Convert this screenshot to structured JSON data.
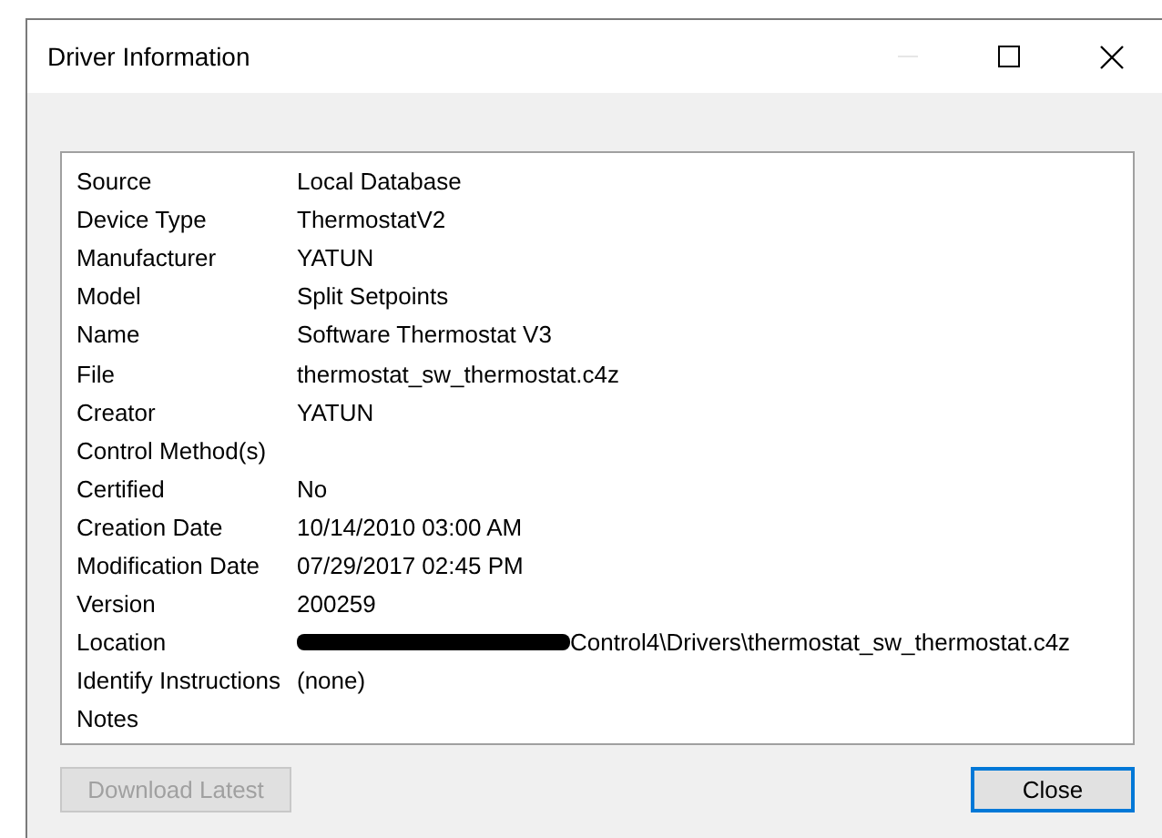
{
  "window": {
    "title": "Driver Information",
    "minimize_disabled": true
  },
  "fields": [
    {
      "label": "Source",
      "value": "Local Database"
    },
    {
      "label": "Device Type",
      "value": "ThermostatV2"
    },
    {
      "label": "Manufacturer",
      "value": "YATUN"
    },
    {
      "label": "Model",
      "value": "Split Setpoints"
    },
    {
      "label": "Name",
      "value": "Software Thermostat V3"
    },
    {
      "label": "File",
      "value": "thermostat_sw_thermostat.c4z"
    },
    {
      "label": "Creator",
      "value": "YATUN"
    },
    {
      "label": "Control Method(s)"
    },
    {
      "label": "Certified",
      "value": "No"
    },
    {
      "label": "Creation Date",
      "value": "10/14/2010 03:00 AM"
    },
    {
      "label": "Modification Date",
      "value": "07/29/2017 02:45 PM"
    },
    {
      "label": "Version",
      "value": "200259"
    },
    {
      "label": "Location",
      "value": "Control4\\Drivers\\thermostat_sw_thermostat.c4z",
      "redacted": true
    },
    {
      "label": "Identify Instructions",
      "value": "(none)"
    },
    {
      "label": "Notes"
    }
  ],
  "buttons": [
    {
      "label": "Download Latest",
      "disabled": true,
      "default": false
    },
    {
      "label": "Close",
      "disabled": false,
      "default": true
    }
  ]
}
